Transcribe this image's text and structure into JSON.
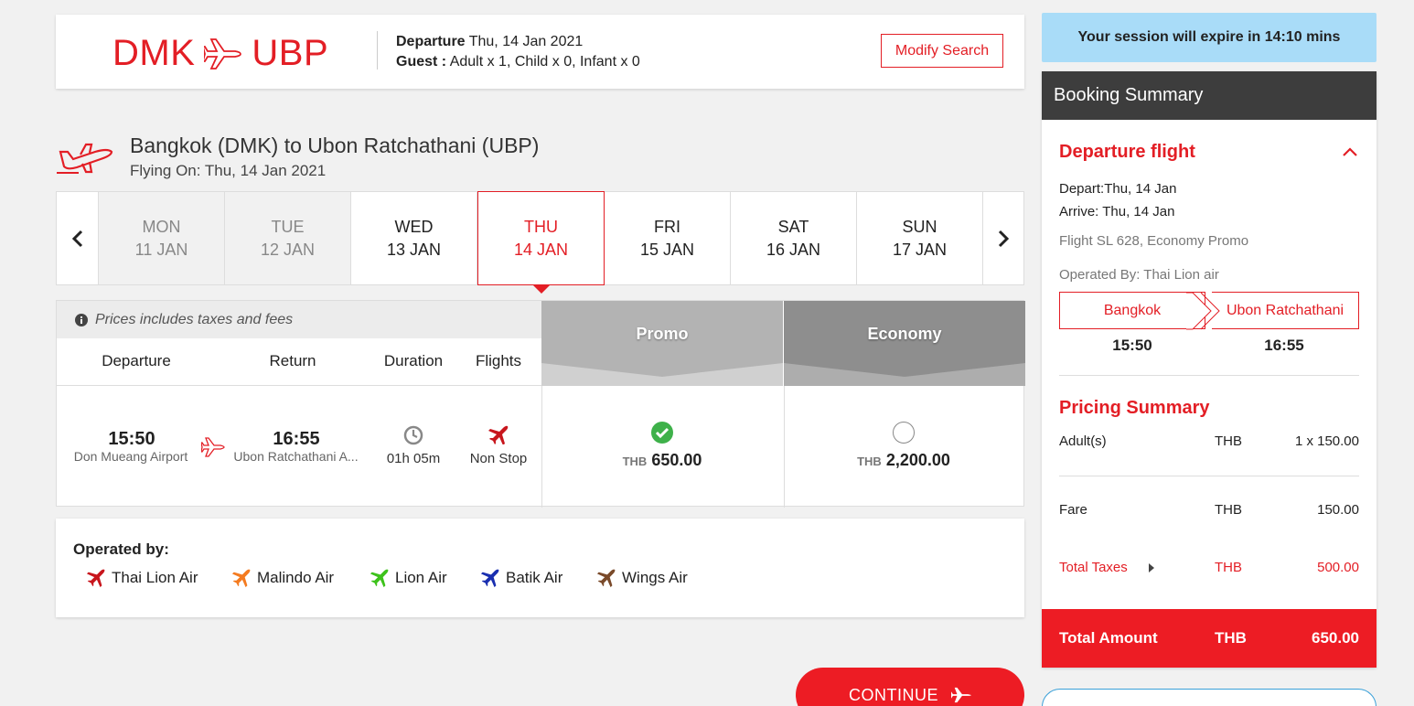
{
  "header": {
    "origin": "DMK",
    "destination": "UBP",
    "departure_label": "Departure",
    "departure_value": "Thu, 14 Jan 2021",
    "guest_label": "Guest :",
    "guest_value": "Adult x 1, Child x 0, Infant x 0",
    "modify_label": "Modify Search"
  },
  "flight": {
    "title": "Bangkok (DMK) to Ubon Ratchathani (UBP)",
    "subtitle": "Flying On: Thu, 14 Jan 2021"
  },
  "dates": [
    {
      "day": "MON",
      "date": "11 JAN"
    },
    {
      "day": "TUE",
      "date": "12 JAN"
    },
    {
      "day": "WED",
      "date": "13 JAN"
    },
    {
      "day": "THU",
      "date": "14 JAN"
    },
    {
      "day": "FRI",
      "date": "15 JAN"
    },
    {
      "day": "SAT",
      "date": "16 JAN"
    },
    {
      "day": "SUN",
      "date": "17 JAN"
    }
  ],
  "results": {
    "tax_note": "Prices includes taxes and fees",
    "col_departure": "Departure",
    "col_return": "Return",
    "col_duration": "Duration",
    "col_flights": "Flights",
    "fare_promo": "Promo",
    "fare_economy": "Economy",
    "row": {
      "dep_time": "15:50",
      "dep_airport": "Don Mueang Airport",
      "arr_time": "16:55",
      "arr_airport": "Ubon Ratchathani A...",
      "duration": "01h 05m",
      "stops": "Non Stop",
      "currency": "THB",
      "promo_price": "650.00",
      "economy_price": "2,200.00"
    }
  },
  "operated": {
    "title": "Operated by:",
    "airlines": [
      {
        "name": "Thai Lion Air",
        "color": "#c8161d"
      },
      {
        "name": "Malindo Air",
        "color": "#f47b20"
      },
      {
        "name": "Lion Air",
        "color": "#3dc21b"
      },
      {
        "name": "Batik Air",
        "color": "#1a2fb0"
      },
      {
        "name": "Wings Air",
        "color": "#7a4a2a"
      }
    ]
  },
  "continue_label": "CONTINUE",
  "sidebar": {
    "session": "Your session will expire in 14:10 mins",
    "summary_title": "Booking Summary",
    "departure_title": "Departure flight",
    "depart": "Depart:Thu, 14 Jan",
    "arrive": "Arrive: Thu, 14 Jan",
    "flight_info": "Flight SL 628, Economy Promo",
    "operated_by": "Operated By: Thai Lion air",
    "from_city": "Bangkok",
    "to_city": "Ubon Ratchathani",
    "from_time": "15:50",
    "to_time": "16:55",
    "pricing_title": "Pricing Summary",
    "adults_label": "Adult(s)",
    "adults_cur": "THB",
    "adults_value": "1 x 150.00",
    "fare_label": "Fare",
    "fare_cur": "THB",
    "fare_value": "150.00",
    "taxes_label": "Total Taxes",
    "taxes_cur": "THB",
    "taxes_value": "500.00",
    "total_label": "Total Amount",
    "total_cur": "THB",
    "total_value": "650.00"
  }
}
